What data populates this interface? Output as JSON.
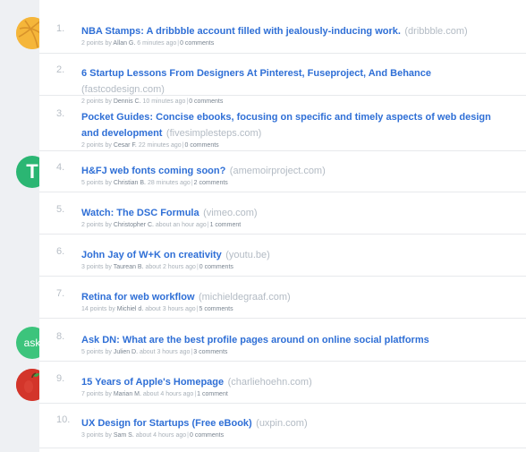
{
  "stories": [
    {
      "rank": "1.",
      "title": "NBA Stamps: A dribbble account filled with jealously-inducing work.",
      "domain": "(dribbble.com)",
      "points": "2 points by",
      "author": "Allan G.",
      "time": "6 minutes ago",
      "comments": "0 comments"
    },
    {
      "rank": "2.",
      "title": "6 Startup Lessons From Designers At Pinterest, Fuseproject, And Behance",
      "domain": "(fastcodesign.com)",
      "points": "2 points by",
      "author": "Dennis C.",
      "time": "10 minutes ago",
      "comments": "0 comments"
    },
    {
      "rank": "3.",
      "title": "Pocket Guides: Concise ebooks, focusing on specific and timely aspects of web design and development",
      "domain": "(fivesimplesteps.com)",
      "points": "2 points by",
      "author": "Cesar F.",
      "time": "22 minutes ago",
      "comments": "0 comments"
    },
    {
      "rank": "4.",
      "title": "H&FJ web fonts coming soon?",
      "domain": "(amemoirproject.com)",
      "points": "5 points by",
      "author": "Christian B.",
      "time": "28 minutes ago",
      "comments": "2 comments"
    },
    {
      "rank": "5.",
      "title": "Watch: The DSC Formula",
      "domain": "(vimeo.com)",
      "points": "2 points by",
      "author": "Christopher C.",
      "time": "about an hour ago",
      "comments": "1 comment"
    },
    {
      "rank": "6.",
      "title": "John Jay of W+K on creativity",
      "domain": "(youtu.be)",
      "points": "3 points by",
      "author": "Taurean B.",
      "time": "about 2 hours ago",
      "comments": "0 comments"
    },
    {
      "rank": "7.",
      "title": "Retina for web workflow",
      "domain": "(michieldegraaf.com)",
      "points": "14 points by",
      "author": "Michiel d.",
      "time": "about 3 hours ago",
      "comments": "5 comments"
    },
    {
      "rank": "8.",
      "title": "Ask DN: What are the best profile pages around on online social platforms",
      "domain": "",
      "points": "5 points by",
      "author": "Julien D.",
      "time": "about 3 hours ago",
      "comments": "3 comments"
    },
    {
      "rank": "9.",
      "title": "15 Years of Apple's Homepage",
      "domain": "(charliehoehn.com)",
      "points": "7 points by",
      "author": "Marian M.",
      "time": "about 4 hours ago",
      "comments": "1 comment"
    },
    {
      "rank": "10.",
      "title": "UX Design for Startups (Free eBook)",
      "domain": "(uxpin.com)",
      "points": "3 points by",
      "author": "Sam S.",
      "time": "about 4 hours ago",
      "comments": "0 comments"
    }
  ],
  "avatars": {
    "t": "T",
    "ask": "ask"
  },
  "colors": {
    "link": "#2f6fd6",
    "dribbble": "#f5b63a",
    "green": "#2bb673",
    "apple_red": "#d3352a"
  },
  "icons": [
    "dribbble-icon",
    "t-badge-icon",
    "ask-badge-icon",
    "apple-icon"
  ]
}
